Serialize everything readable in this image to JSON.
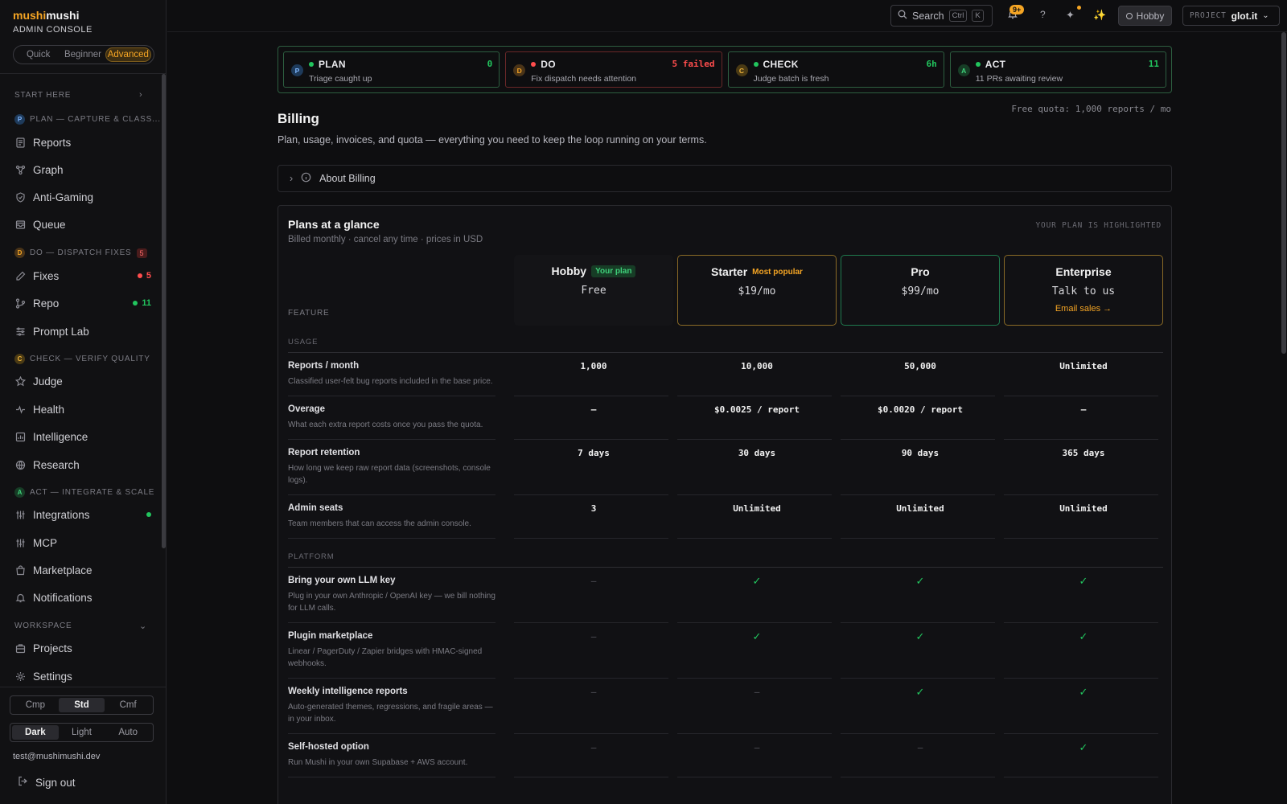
{
  "brand": {
    "part1": "mushi",
    "part2": "mushi",
    "subtitle": "ADMIN CONSOLE"
  },
  "modes": [
    {
      "label": "Quick",
      "active": false
    },
    {
      "label": "Beginner",
      "active": false
    },
    {
      "label": "Advanced",
      "active": true
    }
  ],
  "sidebar": {
    "start_here": "START HERE",
    "plan_section": {
      "chip": "P",
      "label": "PLAN — CAPTURE & CLASS..."
    },
    "plan_items": [
      "Reports",
      "Graph",
      "Anti-Gaming",
      "Queue"
    ],
    "do_section": {
      "chip": "D",
      "label": "DO — DISPATCH FIXES",
      "count": "5"
    },
    "do_items": [
      {
        "label": "Fixes",
        "badge": "5"
      },
      {
        "label": "Repo",
        "badge": "11"
      },
      {
        "label": "Prompt Lab",
        "badge": ""
      }
    ],
    "check_section": {
      "chip": "C",
      "label": "CHECK — VERIFY QUALITY"
    },
    "check_items": [
      "Judge",
      "Health",
      "Intelligence",
      "Research"
    ],
    "act_section": {
      "chip": "A",
      "label": "ACT — INTEGRATE & SCALE"
    },
    "act_items": [
      "Integrations",
      "MCP",
      "Marketplace",
      "Notifications"
    ],
    "workspace": "WORKSPACE",
    "workspace_items": [
      "Projects",
      "Settings"
    ]
  },
  "density": [
    {
      "label": "Cmp",
      "active": false
    },
    {
      "label": "Std",
      "active": true
    },
    {
      "label": "Cmf",
      "active": false
    }
  ],
  "theme": [
    {
      "label": "Dark",
      "active": true
    },
    {
      "label": "Light",
      "active": false
    },
    {
      "label": "Auto",
      "active": false
    }
  ],
  "user": {
    "email": "test@mushimushi.dev",
    "signout": "Sign out"
  },
  "topbar": {
    "search_label": "Search",
    "kbd1": "Ctrl",
    "kbd2": "K",
    "notif_count": "9+",
    "help": "?",
    "plan": "Hobby",
    "project_label": "PROJECT",
    "project_value": "glot.it"
  },
  "pdca": [
    {
      "letter": "P",
      "title": "PLAN",
      "sub": "Triage caught up",
      "value": "0",
      "status": "ok"
    },
    {
      "letter": "D",
      "title": "DO",
      "sub": "Fix dispatch needs attention",
      "value": "5 failed",
      "status": "bad"
    },
    {
      "letter": "C",
      "title": "CHECK",
      "sub": "Judge batch is fresh",
      "value": "6h",
      "status": "ok"
    },
    {
      "letter": "A",
      "title": "ACT",
      "sub": "11 PRs awaiting review",
      "value": "11",
      "status": "ok"
    }
  ],
  "page": {
    "title": "Billing",
    "quota": "Free quota: 1,000 reports / mo",
    "description": "Plan, usage, invoices, and quota — everything you need to keep the loop running on your terms.",
    "about": "About Billing"
  },
  "plans": {
    "title": "Plans at a glance",
    "subtitle": "Billed monthly · cancel any time · prices in USD",
    "hint": "YOUR PLAN IS HIGHLIGHTED",
    "feature_header": "FEATURE",
    "columns": [
      {
        "name": "Hobby",
        "tag": "Your plan",
        "price": "Free",
        "cta": ""
      },
      {
        "name": "Starter",
        "tag": "Most popular",
        "price": "$19/mo",
        "cta": ""
      },
      {
        "name": "Pro",
        "tag": "",
        "price": "$99/mo",
        "cta": ""
      },
      {
        "name": "Enterprise",
        "tag": "",
        "price": "Talk to us",
        "cta": "Email sales →"
      }
    ],
    "groups": [
      {
        "label": "USAGE",
        "rows": [
          {
            "name": "Reports / month",
            "desc": "Classified user-felt bug reports included in the base price.",
            "values": [
              "1,000",
              "10,000",
              "50,000",
              "Unlimited"
            ]
          },
          {
            "name": "Overage",
            "desc": "What each extra report costs once you pass the quota.",
            "values": [
              "—",
              "$0.0025 / report",
              "$0.0020 / report",
              "—"
            ]
          },
          {
            "name": "Report retention",
            "desc": "How long we keep raw report data (screenshots, console logs).",
            "values": [
              "7 days",
              "30 days",
              "90 days",
              "365 days"
            ]
          },
          {
            "name": "Admin seats",
            "desc": "Team members that can access the admin console.",
            "values": [
              "3",
              "Unlimited",
              "Unlimited",
              "Unlimited"
            ]
          }
        ]
      },
      {
        "label": "PLATFORM",
        "rows": [
          {
            "name": "Bring your own LLM key",
            "desc": "Plug in your own Anthropic / OpenAI key — we bill nothing for LLM calls.",
            "values": [
              "–",
              "✓",
              "✓",
              "✓"
            ]
          },
          {
            "name": "Plugin marketplace",
            "desc": "Linear / PagerDuty / Zapier bridges with HMAC-signed webhooks.",
            "values": [
              "–",
              "✓",
              "✓",
              "✓"
            ]
          },
          {
            "name": "Weekly intelligence reports",
            "desc": "Auto-generated themes, regressions, and fragile areas — in your inbox.",
            "values": [
              "–",
              "–",
              "✓",
              "✓"
            ]
          },
          {
            "name": "Self-hosted option",
            "desc": "Run Mushi in your own Supabase + AWS account.",
            "values": [
              "–",
              "–",
              "–",
              "✓"
            ]
          }
        ]
      }
    ]
  }
}
